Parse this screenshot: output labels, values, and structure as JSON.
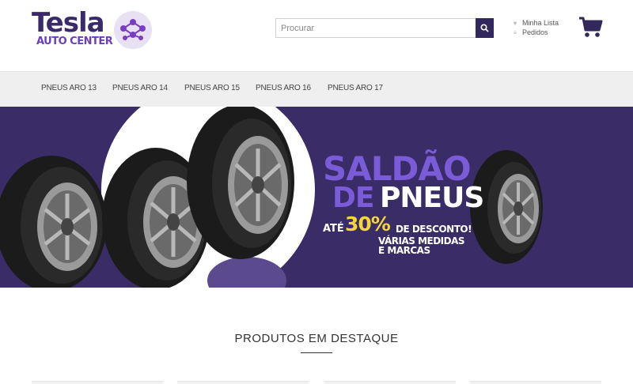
{
  "brand": {
    "name": "Tesla",
    "subtitle": "AUTO CENTER"
  },
  "search": {
    "placeholder": "Procurar",
    "button_icon": "search-icon"
  },
  "account": {
    "wishlist_label": "Minha Lista",
    "wishlist_icon": "heart-icon",
    "orders_label": "Pedidos",
    "orders_icon": "list-icon",
    "cart_icon": "cart-icon"
  },
  "nav": {
    "items": [
      {
        "label": "PNEUS ARO 13"
      },
      {
        "label": "PNEUS ARO 14"
      },
      {
        "label": "PNEUS ARO 15"
      },
      {
        "label": "PNEUS ARO 16"
      },
      {
        "label": "PNEUS ARO 17"
      }
    ]
  },
  "banner": {
    "line1": "SALDÃO",
    "line2a": "DE",
    "line2b": "PNEUS",
    "line3a": "ATÉ",
    "line3b": "30%",
    "line3c": "DE DESCONTO!",
    "line4": "VÁRIAS MEDIDAS E MARCAS"
  },
  "featured": {
    "title": "PRODUTOS EM DESTAQUE"
  },
  "colors": {
    "brand_dark": "#33285e",
    "brand_purple": "#7a5bd8",
    "banner_bg": "#3a2c66",
    "highlight_yellow": "#f4d63b"
  }
}
